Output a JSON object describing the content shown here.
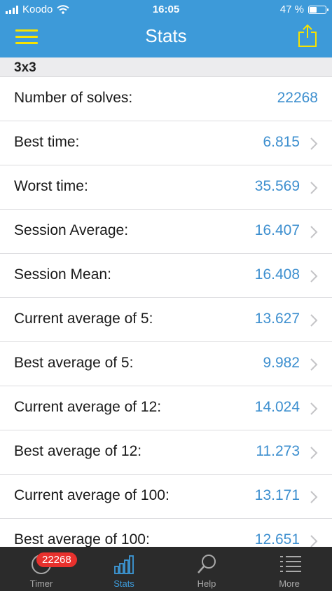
{
  "status_bar": {
    "carrier": "Koodo",
    "time": "16:05",
    "battery": "47 %",
    "battery_level": 0.47
  },
  "nav": {
    "title": "Stats"
  },
  "section": {
    "title": "3x3"
  },
  "rows": [
    {
      "label": "Number of solves:",
      "value": "22268",
      "chevron": false
    },
    {
      "label": "Best time:",
      "value": "6.815",
      "chevron": true
    },
    {
      "label": "Worst time:",
      "value": "35.569",
      "chevron": true
    },
    {
      "label": "Session Average:",
      "value": "16.407",
      "chevron": true
    },
    {
      "label": "Session Mean:",
      "value": "16.408",
      "chevron": true
    },
    {
      "label": "Current average of 5:",
      "value": "13.627",
      "chevron": true
    },
    {
      "label": "Best average of 5:",
      "value": "9.982",
      "chevron": true
    },
    {
      "label": "Current average of 12:",
      "value": "14.024",
      "chevron": true
    },
    {
      "label": "Best average of 12:",
      "value": "11.273",
      "chevron": true
    },
    {
      "label": "Current average of 100:",
      "value": "13.171",
      "chevron": true
    },
    {
      "label": "Best average of 100:",
      "value": "12.651",
      "chevron": true
    }
  ],
  "tabs": [
    {
      "label": "Timer",
      "badge": "22268"
    },
    {
      "label": "Stats"
    },
    {
      "label": "Help"
    },
    {
      "label": "More"
    }
  ],
  "colors": {
    "accent": "#3d9ad9",
    "value_text": "#3d8fcf",
    "icon_yellow": "#f7e200",
    "badge_red": "#e8312d"
  }
}
